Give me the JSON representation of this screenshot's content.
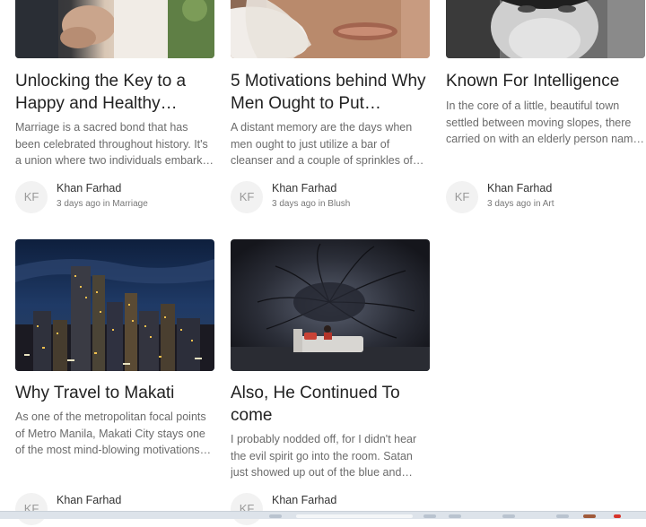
{
  "posts": [
    {
      "title": "Unlocking the Key to a Happy and Healthy…",
      "excerpt": "Marriage is a sacred bond that has been celebrated throughout history. It's a union where two individuals embark o…",
      "author_initials": "KF",
      "author": "Khan Farhad",
      "time": "3 days ago",
      "in": "in",
      "category": "Marriage"
    },
    {
      "title": "5 Motivations behind Why Men Ought to Put…",
      "excerpt": "A distant memory are the days when men ought to just utilize a bar of cleanser and a couple of sprinkles of…",
      "author_initials": "KF",
      "author": "Khan Farhad",
      "time": "3 days ago",
      "in": "in",
      "category": "Blush"
    },
    {
      "title": "Known For Intelligence",
      "excerpt": "In the core of a little, beautiful town settled between moving slopes, there carried on with an elderly person nam…",
      "author_initials": "KF",
      "author": "Khan Farhad",
      "time": "3 days ago",
      "in": "in",
      "category": "Art"
    },
    {
      "title": "Why Travel to Makati",
      "excerpt": "As one of the metropolitan focal points of Metro Manila, Makati City stays one of the most mind-blowing motivations t…",
      "author_initials": "KF",
      "author": "Khan Farhad"
    },
    {
      "title": "Also, He Continued To come",
      "excerpt": "I probably nodded off, for I didn't hear the evil spirit go into the room. Satan just showed up out of the blue and…",
      "author_initials": "KF",
      "author": "Khan Farhad"
    }
  ]
}
